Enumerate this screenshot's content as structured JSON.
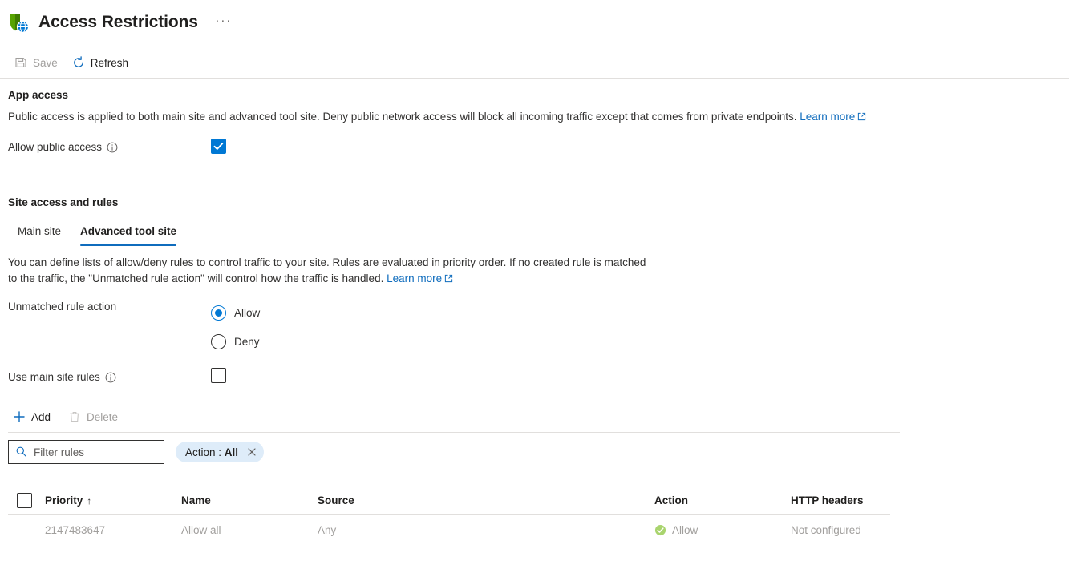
{
  "header": {
    "title": "Access Restrictions",
    "icon": "shield-globe-icon",
    "more_label": "···"
  },
  "commandbar": {
    "save_label": "Save",
    "refresh_label": "Refresh"
  },
  "app_access": {
    "section_title": "App access",
    "description": "Public access is applied to both main site and advanced tool site. Deny public network access will block all incoming traffic except that comes from private endpoints.",
    "learn_more": "Learn more",
    "allow_public_access_label": "Allow public access",
    "allow_public_access_checked": true
  },
  "site_access": {
    "section_title": "Site access and rules",
    "tabs": [
      {
        "label": "Main site",
        "active": false
      },
      {
        "label": "Advanced tool site",
        "active": true
      }
    ],
    "description": "You can define lists of allow/deny rules to control traffic to your site. Rules are evaluated in priority order. If no created rule is matched to the traffic, the \"Unmatched rule action\" will control how the traffic is handled.",
    "learn_more": "Learn more",
    "unmatched_rule_action_label": "Unmatched rule action",
    "unmatched_options": [
      {
        "label": "Allow",
        "selected": true
      },
      {
        "label": "Deny",
        "selected": false
      }
    ],
    "use_main_site_rules_label": "Use main site rules",
    "use_main_site_rules_checked": false
  },
  "rules_toolbar": {
    "add_label": "Add",
    "delete_label": "Delete"
  },
  "filter": {
    "placeholder": "Filter rules",
    "value": "",
    "pill_key": "Action :",
    "pill_value": "All"
  },
  "table": {
    "columns": [
      "Priority",
      "Name",
      "Source",
      "Action",
      "HTTP headers"
    ],
    "sort_column": "Priority",
    "sort_arrow": "↑",
    "rows": [
      {
        "priority": "2147483647",
        "name": "Allow all",
        "source": "Any",
        "action": "Allow",
        "action_icon": "check-circle-icon",
        "http_headers": "Not configured"
      }
    ]
  },
  "colors": {
    "accent": "#0078d4",
    "link": "#0f6cbd",
    "allow_green": "#92c353",
    "pill_bg": "#deecf9",
    "disabled_text": "#a19f9d"
  }
}
